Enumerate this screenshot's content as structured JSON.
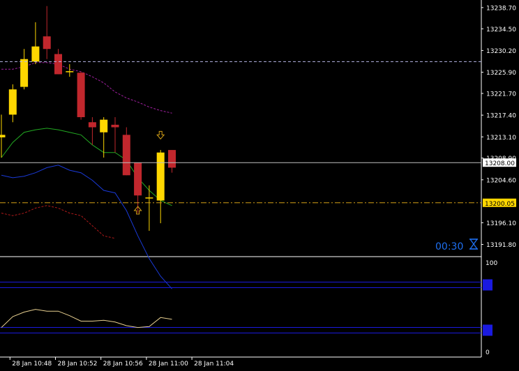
{
  "chart_data": {
    "type": "candlestick",
    "theme": {
      "background": "#000000",
      "axis_text": "#ffffff",
      "bull": "#ffd700",
      "bear": "#c1272d"
    },
    "price_axis": {
      "ylim": [
        13189.8,
        13240.2
      ],
      "ticks": [
        {
          "value": 13238.7,
          "label": "13238.70"
        },
        {
          "value": 13234.5,
          "label": "13234.50"
        },
        {
          "value": 13230.2,
          "label": "13230.20"
        },
        {
          "value": 13225.9,
          "label": "13225.90"
        },
        {
          "value": 13221.7,
          "label": "13221.70"
        },
        {
          "value": 13217.4,
          "label": "13217.40"
        },
        {
          "value": 13213.1,
          "label": "13213.10"
        },
        {
          "value": 13208.9,
          "label": "13208.90"
        },
        {
          "value": 13204.6,
          "label": "13204.60"
        },
        {
          "value": 13196.1,
          "label": "13196.10"
        },
        {
          "value": 13191.8,
          "label": "13191.80"
        }
      ]
    },
    "time_axis": {
      "labels": [
        {
          "index": 1,
          "label": "28 Jan 10:48"
        },
        {
          "index": 5,
          "label": "28 Jan 10:52"
        },
        {
          "index": 9,
          "label": "28 Jan 10:56"
        },
        {
          "index": 13,
          "label": "28 Jan 11:00"
        },
        {
          "index": 17,
          "label": "28 Jan 11:04"
        }
      ]
    },
    "candles": [
      {
        "open": 13213.0,
        "high": 13217.5,
        "low": 13209.0,
        "close": 13213.5
      },
      {
        "open": 13217.5,
        "high": 13223.5,
        "low": 13216.0,
        "close": 13222.5
      },
      {
        "open": 13223.0,
        "high": 13230.5,
        "low": 13222.5,
        "close": 13228.5
      },
      {
        "open": 13228.0,
        "high": 13235.8,
        "low": 13227.5,
        "close": 13231.0
      },
      {
        "open": 13233.0,
        "high": 13239.0,
        "low": 13228.5,
        "close": 13230.5
      },
      {
        "open": 13229.5,
        "high": 13230.5,
        "low": 13225.5,
        "close": 13225.5
      },
      {
        "open": 13226.0,
        "high": 13227.5,
        "low": 13225.0,
        "close": 13226.0
      },
      {
        "open": 13225.8,
        "high": 13226.0,
        "low": 13216.5,
        "close": 13217.0
      },
      {
        "open": 13216.0,
        "high": 13217.0,
        "low": 13211.5,
        "close": 13215.0
      },
      {
        "open": 13214.0,
        "high": 13217.0,
        "low": 13209.0,
        "close": 13216.5
      },
      {
        "open": 13215.5,
        "high": 13217.0,
        "low": 13210.0,
        "close": 13215.0
      },
      {
        "open": 13213.5,
        "high": 13215.0,
        "low": 13205.5,
        "close": 13205.5
      },
      {
        "open": 13208.0,
        "high": 13208.0,
        "low": 13198.0,
        "close": 13201.5
      },
      {
        "open": 13201.0,
        "high": 13203.5,
        "low": 13194.5,
        "close": 13201.0
      },
      {
        "open": 13200.5,
        "high": 13210.5,
        "low": 13196.0,
        "close": 13210.0
      },
      {
        "open": 13210.5,
        "high": 13210.5,
        "low": 13206.0,
        "close": 13207.0
      }
    ],
    "bollinger": {
      "upper": [
        13226.5,
        13226.5,
        13227.0,
        13227.8,
        13227.8,
        13227.5,
        13226.5,
        13226.0,
        13225.0,
        13223.8,
        13222.0,
        13220.8,
        13220.0,
        13219.0,
        13218.3,
        13217.8
      ],
      "middle": [
        13209.0,
        13212.0,
        13214.0,
        13214.5,
        13214.8,
        13214.5,
        13214.0,
        13213.5,
        13211.5,
        13210.0,
        13210.0,
        13208.5,
        13205.0,
        13202.5,
        13200.5,
        13199.5
      ],
      "lower": [
        13205.5,
        13205.0,
        13205.3,
        13206.0,
        13207.0,
        13207.5,
        13206.5,
        13206.0,
        13204.5,
        13202.5,
        13202.0,
        13198.5,
        13193.5,
        13189.0,
        13185.5,
        13183.0
      ],
      "colors": {
        "upper": "#a020a0",
        "middle": "#22aa22",
        "lower": "#1a3ad8"
      }
    },
    "envelope": {
      "lower": [
        13198.0,
        13197.5,
        13198.0,
        13199.0,
        13199.5,
        13199.0,
        13198.0,
        13197.5,
        13195.5,
        13193.5,
        13193.0
      ],
      "color": "#b01a1a"
    },
    "arrows": [
      {
        "index": 12,
        "price": 13198.5,
        "direction": "up",
        "color": "#d4a017"
      },
      {
        "index": 14,
        "price": 13213.5,
        "direction": "down",
        "color": "#d4a017"
      }
    ],
    "hlines": [
      {
        "price": 13228.0,
        "style": "dashed",
        "color": "#b8b8e8"
      },
      {
        "price": 13208.0,
        "style": "solid",
        "color": "#c0c0c0",
        "label": "13208.00",
        "label_bg": "#ffffff",
        "label_color": "#000000"
      },
      {
        "price": 13200.05,
        "style": "dashdot",
        "color": "#d4a017",
        "label": "13200.05",
        "label_bg": "#ffd700",
        "label_color": "#000000"
      }
    ],
    "timer": {
      "text": "00:30",
      "icon": "hourglass-icon",
      "color": "#1e6ff0"
    },
    "oscillator": {
      "ylim": [
        0,
        100
      ],
      "tick_labels": [
        "100",
        "0"
      ],
      "levels": [
        {
          "value": 75,
          "color": "#1a1ae0"
        },
        {
          "value": 25,
          "color": "#1a1ae0"
        }
      ],
      "line": {
        "color": "#e8d090",
        "values": [
          28,
          40,
          45,
          48,
          46,
          46,
          41,
          35,
          35,
          36,
          34,
          30,
          28,
          29,
          39,
          37
        ]
      }
    }
  }
}
